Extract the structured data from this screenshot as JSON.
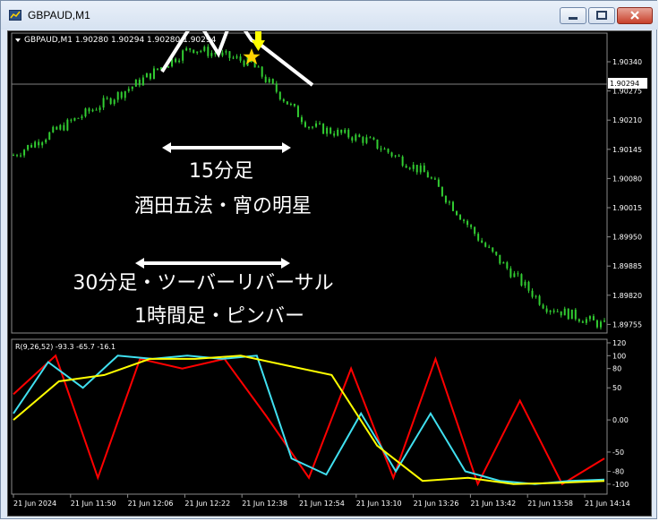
{
  "window": {
    "title": "GBPAUD,M1",
    "buttons": [
      "minimize",
      "maximize",
      "close"
    ]
  },
  "chart": {
    "header": "GBPAUD,M1  1.90280 1.90294 1.90280 1.90294",
    "current_price_tag": "1.90294",
    "price_scale": [
      "1.90340",
      "1.90275",
      "1.90210",
      "1.90145",
      "1.90080",
      "1.90015",
      "1.89950",
      "1.89885",
      "1.89820",
      "1.89755"
    ],
    "time_scale": [
      "21 Jun 2024",
      "21 Jun 11:50",
      "21 Jun 12:06",
      "21 Jun 12:22",
      "21 Jun 12:38",
      "21 Jun 12:54",
      "21 Jun 13:10",
      "21 Jun 13:26",
      "21 Jun 13:42",
      "21 Jun 13:58",
      "21 Jun 14:14"
    ],
    "annotations": {
      "line1": "15分足",
      "line2": "酒田五法・宵の明星",
      "line3": "30分足・ツーバーリバーサル",
      "line4": "1時間足・ピンバー"
    },
    "indicator": {
      "label": "R(9,26,52) -93.3 -65.7 -16.1",
      "scale": [
        "120",
        "100",
        "80",
        "50",
        "0.00",
        "-50",
        "-80",
        "-100"
      ]
    },
    "colors": {
      "background": "#000000",
      "candle": "#32cd32",
      "annotation": "#ffffff",
      "marker": "#ffff00",
      "line_red": "#ff0000",
      "line_cyan": "#40e0f0",
      "line_yellow": "#ffff00"
    }
  },
  "chart_data": {
    "type": "line",
    "title": "GBPAUD,M1",
    "xlabel": "",
    "ylabel": "",
    "ylim": [
      1.89755,
      1.9037
    ],
    "x": [
      "21 Jun 2024",
      "21 Jun 11:50",
      "21 Jun 12:06",
      "21 Jun 12:22",
      "21 Jun 12:38",
      "21 Jun 12:54",
      "21 Jun 13:10",
      "21 Jun 13:26",
      "21 Jun 13:42",
      "21 Jun 13:58",
      "21 Jun 14:14"
    ],
    "series": [
      {
        "name": "",
        "values": [
          1.9012,
          1.9019,
          1.9026,
          1.9034,
          1.9031,
          1.9018,
          1.9015,
          1.9008,
          1.8993,
          1.8981,
          1.8977
        ]
      }
    ],
    "sub_chart": {
      "type": "line",
      "label": "R(9,26,52) -93.3 -65.7 -16.1",
      "ylim": [
        -110,
        120
      ],
      "series": [
        {
          "values": [
            40,
            100,
            -90,
            95,
            80,
            95,
            5,
            -90,
            80,
            -90,
            95,
            -100,
            30,
            -100,
            -60
          ]
        },
        {
          "values": [
            10,
            90,
            50,
            100,
            95,
            100,
            95,
            100,
            -60,
            -85,
            10,
            -80,
            10,
            -80,
            -95,
            -100,
            -95,
            -93
          ]
        },
        {
          "values": [
            0,
            60,
            70,
            95,
            95,
            100,
            85,
            70,
            -40,
            -95,
            -90,
            -100,
            -98,
            -95
          ]
        }
      ]
    }
  }
}
